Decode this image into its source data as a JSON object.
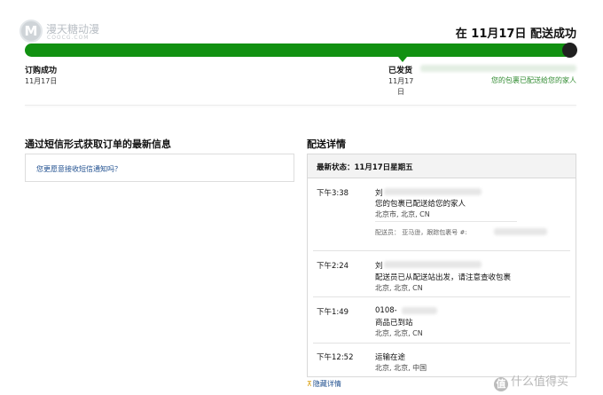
{
  "watermark_top": {
    "logo_letter": "M",
    "name": "漫天糖动漫",
    "domain_text": "COOCG.COM"
  },
  "status": {
    "title": "在 11月17日 配送成功"
  },
  "progress": {
    "fraction": 1.0,
    "color": "#119111",
    "steps": [
      {
        "label": "订购成功",
        "date": "11月17日"
      },
      {
        "label": "已发货",
        "date_line1": "11月17",
        "date_line2": "日"
      }
    ],
    "delivered_msg": "您的包裹已配送给您的家人"
  },
  "sms": {
    "heading": "通过短信形式获取订单的最新信息",
    "link": "您更愿意接收短信通知吗？"
  },
  "shipping": {
    "heading": "配送详情",
    "latest": "最新状态：11月17日星期五",
    "events": [
      {
        "time": "下午3:38",
        "line1": "刘",
        "line2": "您的包裹已配送给您的家人",
        "location": "北京市, 北京, CN",
        "extra": "配送员： 亚马逊，跟踪包裹号 #:"
      },
      {
        "time": "下午2:24",
        "line1": "刘",
        "line2": "配送员已从配送站出发，请注意查收包裹",
        "location": "北京, 北京, CN"
      },
      {
        "time": "下午1:49",
        "line1": "0108-",
        "line2": "商品已到站",
        "location": "北京, 北京, CN"
      },
      {
        "time": "下午12:52",
        "line1": "运输在途",
        "location": "北京, 北京, 中国"
      }
    ],
    "hide_link": "隐藏详情"
  },
  "watermark_bottom": {
    "badge": "值",
    "text": "什么值得买"
  },
  "colors": {
    "accent_green": "#119111",
    "link_blue": "#1f4f8f",
    "delivered_green": "#2f8a2f"
  }
}
